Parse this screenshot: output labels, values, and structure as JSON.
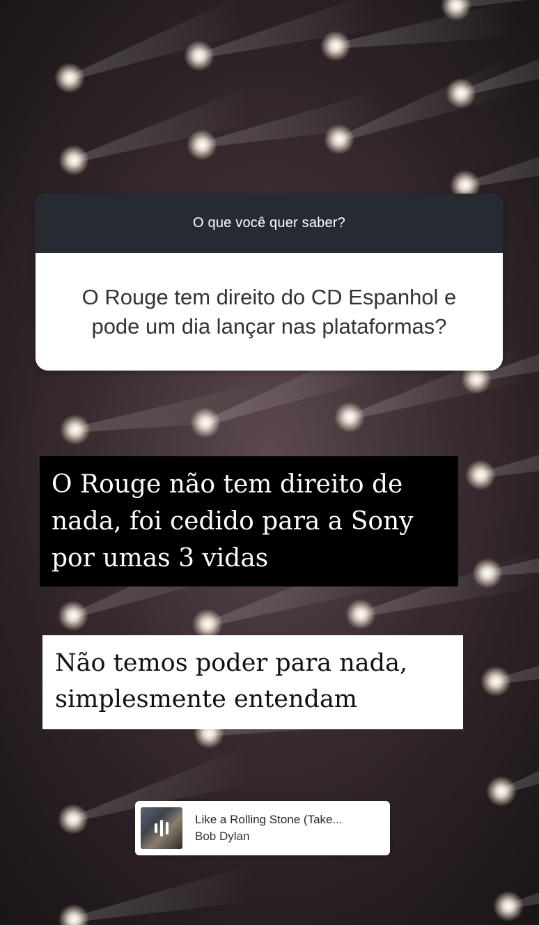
{
  "question_sticker": {
    "header": "O que você quer saber?",
    "question": "O Rouge tem direito do CD Espanhol e pode um dia lançar nas plataformas?"
  },
  "captions": {
    "dark_lines": [
      "O Rouge não tem direito de",
      "nada, foi cedido para a Sony",
      "por umas 3 vidas"
    ],
    "light_lines": [
      "Não temos poder para nada,",
      "simplesmente entendam"
    ]
  },
  "music_sticker": {
    "song": "Like a Rolling Stone (Take...",
    "artist": "Bob Dylan"
  },
  "colors": {
    "question_header_bg": "#262a31",
    "dark_caption_bg": "#000000",
    "light_caption_bg": "#ffffff"
  },
  "background": {
    "description_icon": "stage-lights-icon"
  }
}
